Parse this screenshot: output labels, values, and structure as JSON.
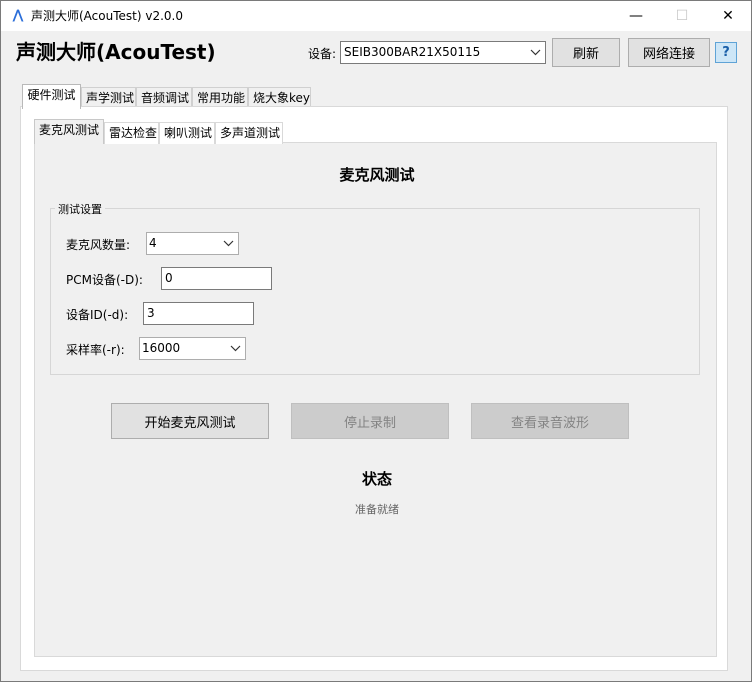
{
  "window": {
    "title": "声测大师(AcouTest) v2.0.0",
    "icon": "app-logo-icon",
    "minimize_glyph": "—",
    "maximize_glyph": "☐",
    "close_glyph": "✕"
  },
  "header": {
    "app_title": "声测大师(AcouTest)",
    "device_label": "设备:",
    "device_value": "SEIB300BAR21X50115",
    "refresh_label": "刷新",
    "network_label": "网络连接",
    "help_label": "?"
  },
  "main_tabs": [
    {
      "label": "硬件测试",
      "active": true
    },
    {
      "label": "声学测试"
    },
    {
      "label": "音频调试"
    },
    {
      "label": "常用功能"
    },
    {
      "label": "烧大象key"
    }
  ],
  "sub_tabs": [
    {
      "label": "麦克风测试",
      "active": true
    },
    {
      "label": "雷达检查"
    },
    {
      "label": "喇叭测试"
    },
    {
      "label": "多声道测试"
    }
  ],
  "mic_test": {
    "title": "麦克风测试",
    "settings_group": "测试设置",
    "mic_count_label": "麦克风数量:",
    "mic_count_value": "4",
    "pcm_label": "PCM设备(-D):",
    "pcm_value": "0",
    "device_id_label": "设备ID(-d):",
    "device_id_value": "3",
    "sample_rate_label": "采样率(-r):",
    "sample_rate_value": "16000",
    "start_button": "开始麦克风测试",
    "stop_button": "停止录制",
    "waveform_button": "查看录音波形",
    "status_title": "状态",
    "status_value": "准备就绪"
  }
}
